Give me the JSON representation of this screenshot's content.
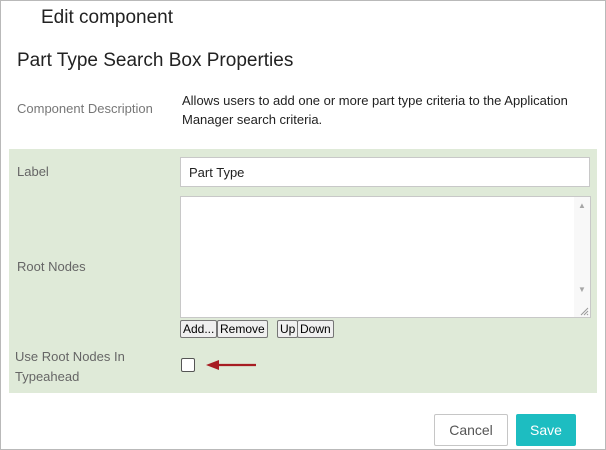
{
  "dialog": {
    "title": "Edit component",
    "section_title": "Part Type Search Box Properties"
  },
  "description": {
    "label": "Component Description",
    "text": "Allows users to add one or more part type criteria to the Application Manager search criteria."
  },
  "form": {
    "label_field": {
      "label": "Label",
      "value": "Part Type"
    },
    "root_nodes": {
      "label": "Root Nodes",
      "items": [],
      "buttons": {
        "add": "Add...",
        "remove": "Remove",
        "up": "Up",
        "down": "Down"
      }
    },
    "use_root_nodes": {
      "label_line1": "Use Root Nodes In",
      "label_line2": "Typeahead",
      "checked": false
    }
  },
  "footer": {
    "cancel": "Cancel",
    "save": "Save"
  },
  "colors": {
    "panel_bg": "#dfead8",
    "save_bg": "#1dbdc1",
    "arrow": "#a71d22"
  },
  "icons": {
    "scroll_up": "scroll-up-icon",
    "scroll_down": "scroll-down-icon",
    "pointer": "red-arrow-icon"
  }
}
